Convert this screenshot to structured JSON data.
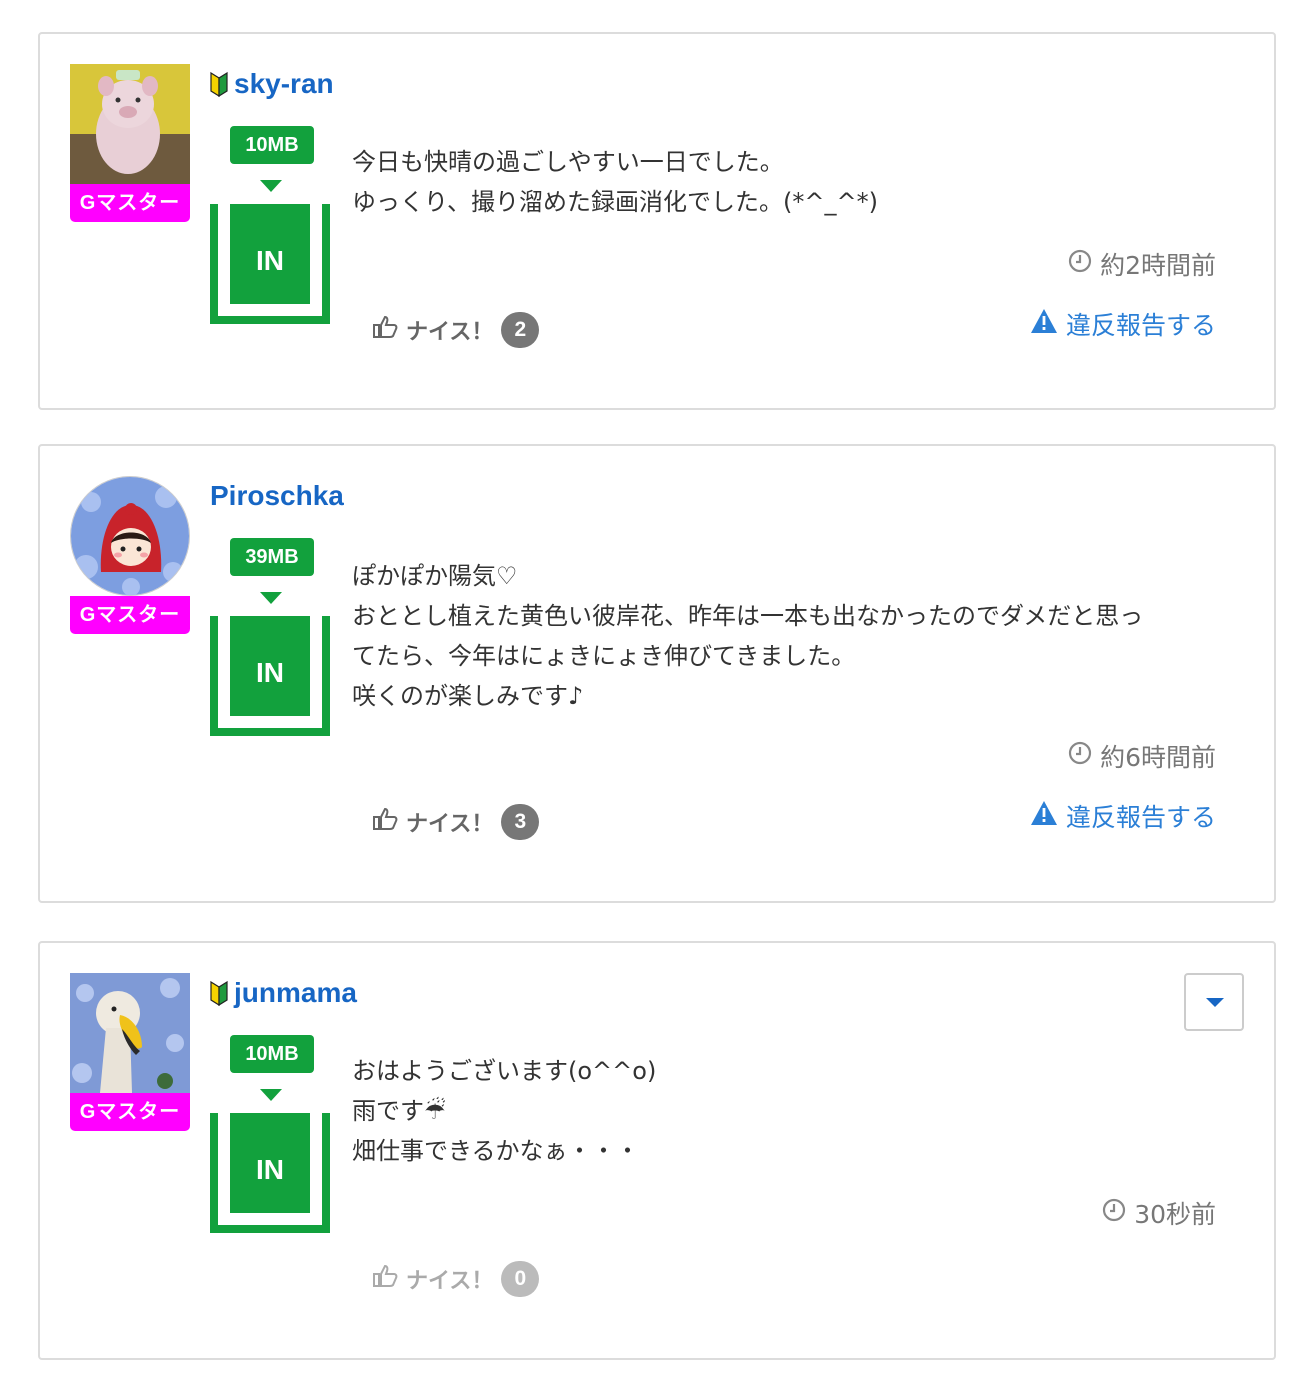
{
  "posts": [
    {
      "username": "sky-ran",
      "beginner_mark": true,
      "rank_badge": "Gマスター",
      "data_amount": "10MB",
      "status": "IN",
      "message_lines": [
        "今日も快晴の過ごしやすい一日でした。",
        "ゆっくり、撮り溜めた録画消化でした。(*^_^*)"
      ],
      "time": "約2時間前",
      "report_label": "違反報告する",
      "nice_label": "ナイス！",
      "nice_count": "2"
    },
    {
      "username": "Piroschka",
      "beginner_mark": false,
      "rank_badge": "Gマスター",
      "data_amount": "39MB",
      "status": "IN",
      "message_lines": [
        "ぽかぽか陽気♡",
        "おととし植えた黄色い彼岸花、昨年は一本も出なかったのでダメだと思っ",
        "てたら、今年はにょきにょき伸びてきました。",
        "咲くのが楽しみです♪"
      ],
      "time": "約6時間前",
      "report_label": "違反報告する",
      "nice_label": "ナイス！",
      "nice_count": "3"
    },
    {
      "username": "junmama",
      "beginner_mark": true,
      "rank_badge": "Gマスター",
      "data_amount": "10MB",
      "status": "IN",
      "message_lines": [
        "おはようございます(o^^o)",
        "雨です☔",
        "畑仕事できるかなぁ・・・"
      ],
      "time": "30秒前",
      "nice_label": "ナイス！",
      "nice_count": "0"
    }
  ],
  "icons": {
    "clock": "clock-icon",
    "warning": "warning-icon",
    "thumbs_up": "thumbs-up-icon",
    "beginner": "beginner-mark-icon",
    "dropdown": "caret-down-icon"
  },
  "colors": {
    "username": "#1766c4",
    "rank_badge": "#ff00ff",
    "status_green": "#12a13d",
    "report_link": "#2b7fd6"
  }
}
